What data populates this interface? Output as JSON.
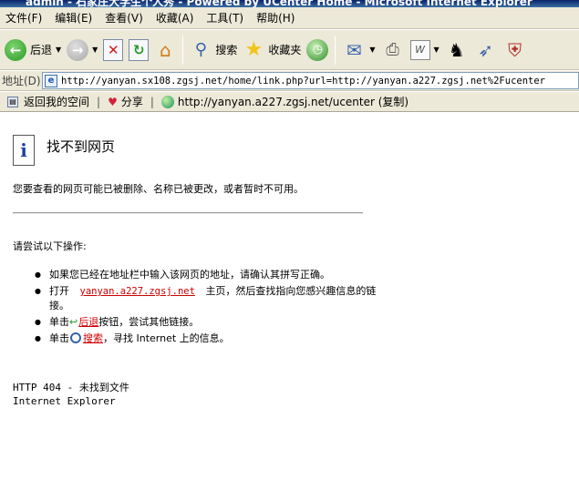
{
  "window": {
    "title": "admin - 石家庄大学生个人秀 - Powered by UCenter Home - Microsoft Internet Explorer"
  },
  "menubar": {
    "items": [
      "文件(F)",
      "编辑(E)",
      "查看(V)",
      "收藏(A)",
      "工具(T)",
      "帮助(H)"
    ]
  },
  "toolbar": {
    "back_label": "后退",
    "search_label": "搜索",
    "favorites_label": "收藏夹"
  },
  "addressbar": {
    "label": "地址(D)",
    "url": "http://yanyan.sx108.zgsj.net/home/link.php?url=http://yanyan.a227.zgsj.net%2Fucenter"
  },
  "linksbar": {
    "back_to_space": "返回我的空间",
    "share": "分享",
    "link_text": "http://yanyan.a227.zgsj.net/ucenter (复制)"
  },
  "content": {
    "title": "找不到网页",
    "description": "您要查看的网页可能已被删除、名称已被更改，或者暂时不可用。",
    "try_text": "请尝试以下操作:",
    "item1": "如果您已经在地址栏中输入该网页的地址，请确认其拼写正确。",
    "item2_prefix": "打开",
    "item2_link": "yanyan.a227.zgsj.net",
    "item2_suffix": "主页，然后查找指向您感兴趣信息的链接。",
    "item3_prefix": "单击",
    "item3_link": "后退",
    "item3_suffix": "按钮，尝试其他链接。",
    "item4_prefix": "单击",
    "item4_link": "搜索",
    "item4_suffix": "，寻找 Internet 上的信息。",
    "error_code": "HTTP 404 - 未找到文件",
    "browser": "Internet Explorer"
  }
}
